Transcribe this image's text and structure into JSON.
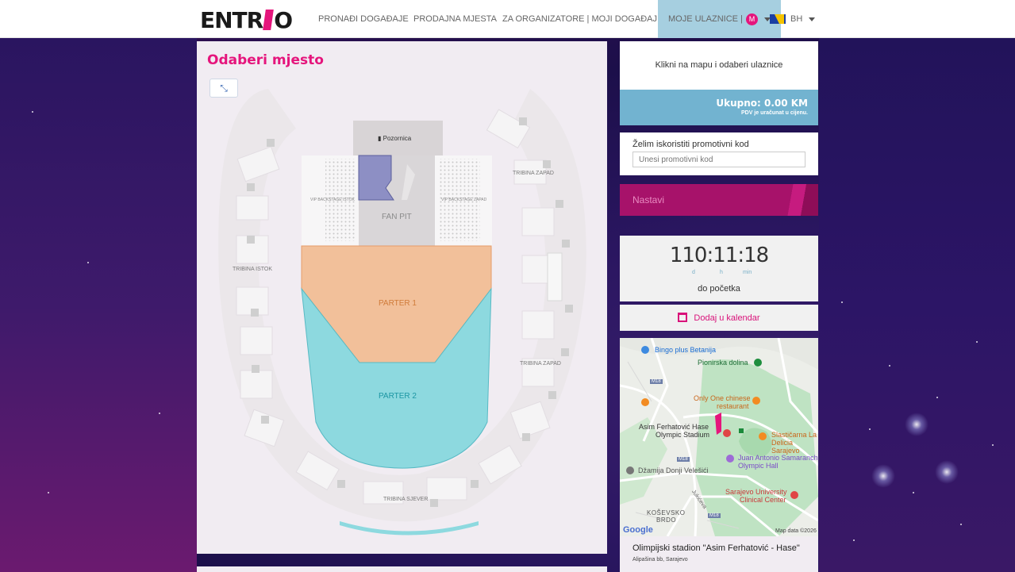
{
  "header": {
    "logo": "ENTRIO",
    "nav": [
      {
        "label": "PRONAĐI DOGAĐAJE"
      },
      {
        "label": "PRODAJNA MJESTA"
      },
      {
        "label": "ZA ORGANIZATORE | MOJI DOGAĐAJI"
      },
      {
        "label": "MOJE ULAZNICE |"
      },
      {
        "label": "BH"
      }
    ],
    "user_badge": "M"
  },
  "seating": {
    "title": "Odaberi mjesto",
    "stage": "Pozornica",
    "fan_pit": "FAN PIT",
    "vip_left": "VIP BACKSTAGE ISTOK",
    "vip_right": "VIP BACKSTAGE ZAPAD",
    "parter1": "PARTER 1",
    "parter2": "PARTER 2",
    "tribina_istok": "TRIBINA ISTOK",
    "tribina_zapad_top": "TRIBINA ZAPAD",
    "tribina_zapad_bottom": "TRIBINA ZAPAD",
    "tribina_sjever": "TRIBINA SJEVER",
    "colors": {
      "parter1": "#f2c09a",
      "parter2": "#8dd9df",
      "accent": "#e5157c"
    }
  },
  "cart": {
    "hint": "Klikni na mapu i odaberi ulaznice",
    "total": "Ukupno: 0.00 KM",
    "vat_note": "PDV je uračunat u cijenu."
  },
  "promo": {
    "label": "Želim iskoristiti promotivni kod",
    "placeholder": "Unesi promotivni kod"
  },
  "next_button": "Nastavi",
  "countdown": {
    "days": "110",
    "hours": "11",
    "minutes": "18",
    "d": "d",
    "h": "h",
    "min": "min",
    "label": "do početka"
  },
  "calendar": "Dodaj u kalendar",
  "map": {
    "places": [
      "Bingo plus Betanija",
      "Pionirska dolina",
      "Only One chinese",
      "restaurant",
      "Asim Ferhatović Hase",
      "Olympic Stadium",
      "Slastičarna La",
      "Delicia Sarajevo",
      "Juan Antonio Samaranch",
      "Olympic Hall",
      "Džamija Donji Velešići",
      "Sarajevo University",
      "Clinical Center",
      "KOŠEVSKO",
      "BRDO",
      "Jukićeva"
    ],
    "roads": [
      "M18",
      "M18",
      "M18"
    ],
    "google": "Google",
    "attribution": "Map data ©2026"
  },
  "venue": {
    "name": "Olimpijski stadion \"Asim Ferhatović - Hase\"",
    "address": "Alipašina bb, Sarajevo"
  }
}
